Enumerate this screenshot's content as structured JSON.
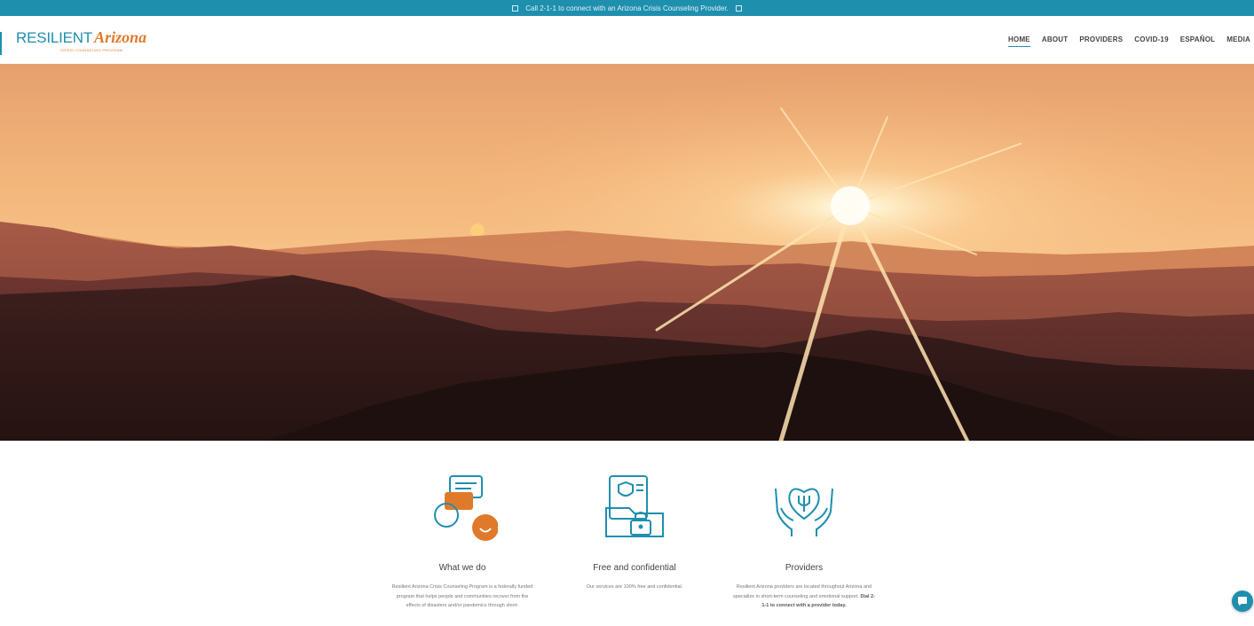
{
  "announcement": {
    "text": "Call 2-1-1 to connect with an Arizona Crisis Counseling Provider."
  },
  "logo": {
    "word1": "RESILIENT",
    "word2": "Arizona",
    "tagline": "CRISIS COUNSELING PROGRAM"
  },
  "nav": {
    "items": [
      {
        "label": "HOME",
        "active": true
      },
      {
        "label": "ABOUT"
      },
      {
        "label": "PROVIDERS"
      },
      {
        "label": "COVID-19"
      },
      {
        "label": "ESPAÑOL"
      },
      {
        "label": "MEDIA"
      }
    ]
  },
  "features": [
    {
      "title": "What we do",
      "desc": "Resilient Arizona Crisis Counseling Program is a federally funded program that helps people and communities recover from the effects of disasters and/or pandemics through short-",
      "icon": "chat-bubbles-icon"
    },
    {
      "title": "Free and confidential",
      "desc": "Our services are 100% free and confidential.",
      "icon": "secure-folder-icon"
    },
    {
      "title": "Providers",
      "desc": "Resilient Arizona providers are located throughout Arizona and specialize in short-term counseling and emotional support.",
      "desc_bold": "Dial 2-1-1 to connect with a provider today.",
      "icon": "hands-heart-icon"
    }
  ],
  "colors": {
    "brand_teal": "#1f8fae",
    "brand_orange": "#e07a2b"
  }
}
